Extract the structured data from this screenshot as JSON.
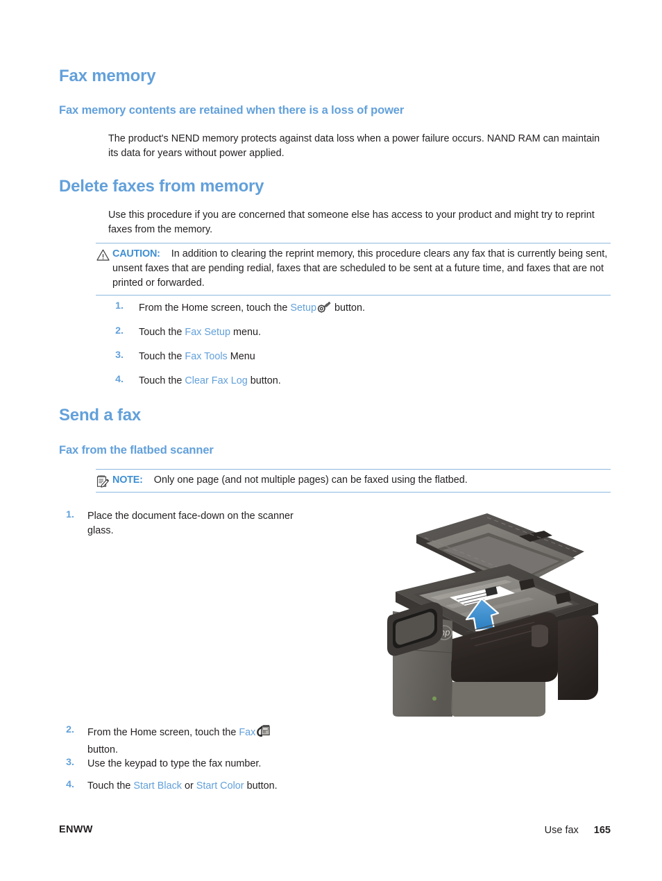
{
  "page": {
    "footer_left": "ENWW",
    "footer_section": "Use fax",
    "footer_page_number": "165",
    "accent_color": "#62a0da",
    "admonition_rule_color": "#8cb9e0",
    "text_color": "#231f20"
  },
  "sections": {
    "fax_memory": {
      "heading": "Fax memory",
      "subheading": "Fax memory contents are retained when there is a loss of power",
      "paragraph": "The product's NEND memory protects against data loss when a power failure occurs. NAND RAM can maintain its data for years without power applied."
    },
    "delete_faxes": {
      "heading": "Delete faxes from memory",
      "paragraph": "Use this procedure if you are concerned that someone else has access to your product and might try to reprint faxes from the memory.",
      "caution": {
        "icon": "warning-triangle-icon",
        "label": "CAUTION:",
        "text": "In addition to clearing the reprint memory, this procedure clears any fax that is currently being sent, unsent faxes that are pending redial, faxes that are scheduled to be sent at a future time, and faxes that are not printed or forwarded."
      },
      "steps": [
        {
          "num": "1.",
          "before": "From the Home screen, touch the ",
          "keyword": "Setup",
          "icon": "setup-wrench-gear-icon",
          "after": " button."
        },
        {
          "num": "2.",
          "before": "Touch the ",
          "keyword": "Fax Setup",
          "icon": null,
          "after": " menu."
        },
        {
          "num": "3.",
          "before": "Touch the ",
          "keyword": "Fax Tools",
          "icon": null,
          "after": " Menu"
        },
        {
          "num": "4.",
          "before": "Touch the ",
          "keyword": "Clear Fax Log",
          "icon": null,
          "after": " button."
        }
      ]
    },
    "send_a_fax": {
      "heading": "Send a fax",
      "subheading": "Fax from the flatbed scanner",
      "note": {
        "icon": "notepad-pencil-icon",
        "label": "NOTE:",
        "text": "Only one page (and not multiple pages) can be faxed using the flatbed."
      },
      "steps": [
        {
          "num": "1.",
          "text": "Place the document face-down on the scanner glass.",
          "illustration": "hp-flatbed-scanner-printer-illustration"
        },
        {
          "num": "2.",
          "before": "From the Home screen, touch the ",
          "keyword": "Fax",
          "icon": "fax-machine-icon",
          "after": " button."
        },
        {
          "num": "3.",
          "text": "Use the keypad to type the fax number."
        },
        {
          "num": "4.",
          "before": "Touch the ",
          "keyword": "Start Black",
          "middle": " or ",
          "keyword2": "Start Color",
          "after": " button."
        }
      ]
    }
  }
}
